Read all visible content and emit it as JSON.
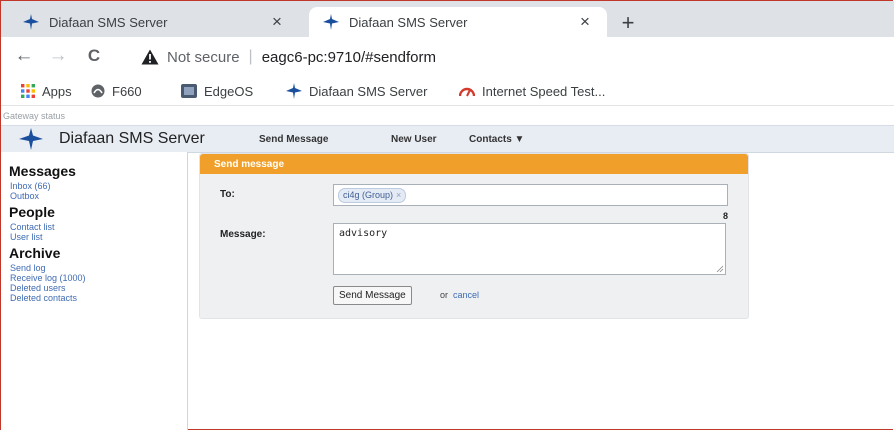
{
  "browser": {
    "tabs": [
      {
        "title": "Diafaan SMS Server",
        "close": "×"
      },
      {
        "title": "Diafaan SMS Server",
        "close": "×"
      }
    ],
    "new_tab": "+",
    "nav": {
      "back": "←",
      "forward": "→",
      "reload": "C"
    },
    "not_secure": "Not secure",
    "separator": "|",
    "url": "eagc6-pc:9710/#sendform",
    "bookmarks": [
      "Apps",
      "F660",
      "EdgeOS",
      "Diafaan SMS Server",
      "Internet Speed Test..."
    ]
  },
  "page": {
    "gateway_status": "Gateway status",
    "app_name": "Diafaan SMS Server",
    "top_nav": [
      "Send Message",
      "New User",
      "Contacts ▼"
    ]
  },
  "sidebar": {
    "messages_heading": "Messages",
    "messages_links": [
      "Inbox (66)",
      "Outbox"
    ],
    "people_heading": "People",
    "people_links": [
      "Contact list",
      "User list"
    ],
    "archive_heading": "Archive",
    "archive_links": [
      "Send log",
      "Receive log (1000)",
      "Deleted users",
      "Deleted contacts"
    ]
  },
  "form": {
    "header": "Send message",
    "to_label": "To:",
    "to_tag": "ci4g (Group)",
    "tag_remove": "×",
    "message_label": "Message:",
    "char_count": "8",
    "message_value": "advisory",
    "send_button": "Send Message",
    "or_text": "or",
    "cancel_link": "cancel"
  },
  "colors": {
    "form_header": "#f0a02a",
    "link": "#3f6bb3",
    "app_header": "#e8edf3",
    "border_accent": "#c1372a"
  },
  "icons": [
    "diafaan-favicon",
    "close-icon",
    "plus-icon",
    "back-arrow-icon",
    "forward-arrow-icon",
    "reload-icon",
    "warning-icon",
    "apps-grid-icon",
    "f660-icon",
    "edgeos-icon",
    "speedtest-icon",
    "diafaan-logo",
    "resize-grip-icon"
  ]
}
